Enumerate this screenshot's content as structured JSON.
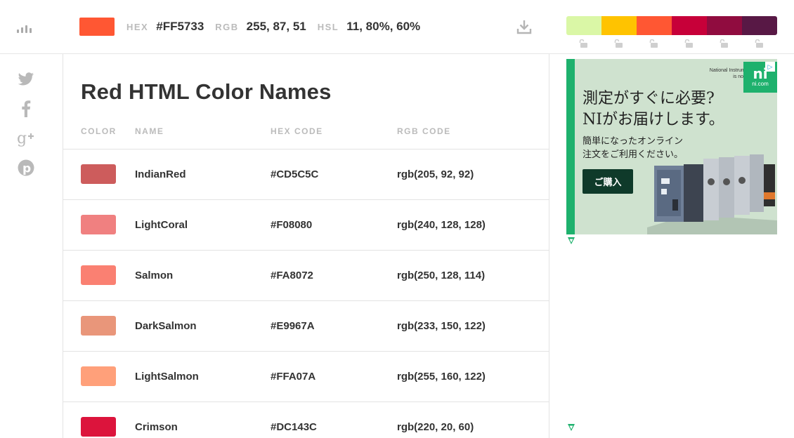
{
  "toolbar": {
    "current_color": "#FF5733",
    "hex_label": "HEX",
    "hex_value": "#FF5733",
    "rgb_label": "RGB",
    "rgb_value": "255, 87, 51",
    "hsl_label": "HSL",
    "hsl_value": "11, 80%, 60%",
    "menu_icon": "bars-icon",
    "download_icon": "download-icon"
  },
  "palette": {
    "colors": [
      "#DAF7A6",
      "#FFC300",
      "#FF5733",
      "#C70039",
      "#900C3F",
      "#581845"
    ],
    "lock_icon": "unlock-icon"
  },
  "social": [
    "twitter-icon",
    "facebook-icon",
    "google-plus-icon",
    "pinterest-icon"
  ],
  "main": {
    "title": "Red HTML Color Names",
    "columns": [
      "COLOR",
      "NAME",
      "HEX CODE",
      "RGB CODE"
    ],
    "rows": [
      {
        "color": "#CD5C5C",
        "name": "IndianRed",
        "hex": "#CD5C5C",
        "rgb": "rgb(205, 92, 92)"
      },
      {
        "color": "#F08080",
        "name": "LightCoral",
        "hex": "#F08080",
        "rgb": "rgb(240, 128, 128)"
      },
      {
        "color": "#FA8072",
        "name": "Salmon",
        "hex": "#FA8072",
        "rgb": "rgb(250, 128, 114)"
      },
      {
        "color": "#E9967A",
        "name": "DarkSalmon",
        "hex": "#E9967A",
        "rgb": "rgb(233, 150, 122)"
      },
      {
        "color": "#FFA07A",
        "name": "LightSalmon",
        "hex": "#FFA07A",
        "rgb": "rgb(255, 160, 122)"
      },
      {
        "color": "#DC143C",
        "name": "Crimson",
        "hex": "#DC143C",
        "rgb": "rgb(220, 20, 60)"
      }
    ]
  },
  "ad": {
    "top_text_1": "National Instruments",
    "top_text_2": "is now NI.",
    "logo_main": "ni",
    "logo_sub": "ni.com",
    "headline_1": "測定がすぐに必要?",
    "headline_2": "NIがお届けします。",
    "sub_1": "簡単になったオンライン",
    "sub_2": "注文をご利用ください。",
    "button": "ご購入",
    "info_icon": "ad-choices-icon",
    "accent": "#1EB16D"
  }
}
